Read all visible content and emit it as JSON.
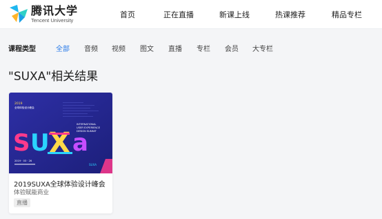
{
  "header": {
    "logo_cn": "腾讯大学",
    "logo_en": "Tencent University",
    "nav": [
      "首页",
      "正在直播",
      "新课上线",
      "热课推荐",
      "精品专栏"
    ]
  },
  "filter": {
    "label": "课程类型",
    "items": [
      "全部",
      "音频",
      "视频",
      "图文",
      "直播",
      "专栏",
      "会员",
      "大专栏"
    ],
    "active": "全部"
  },
  "results": {
    "title": "\"SUXA\"相关结果"
  },
  "course": {
    "title": "2019SUXA全球体验设计峰会",
    "subtitle": "体验赋能商业",
    "tag": "直播",
    "poster": {
      "year": "2019",
      "line1": "全球体验设计峰会",
      "line2": "INTERNATIONAL",
      "line3": "USER EXPERIENCE",
      "line4": "DESIGN SUMMIT",
      "date": "2019 · 03 · 26",
      "brand": "SUXA"
    }
  },
  "colors": {
    "accent": "#2b7ce9",
    "poster_bg": "#2a2d9a",
    "poster_deep": "#1c1f7a"
  },
  "icons": [
    "tencent-university-logo-icon"
  ]
}
